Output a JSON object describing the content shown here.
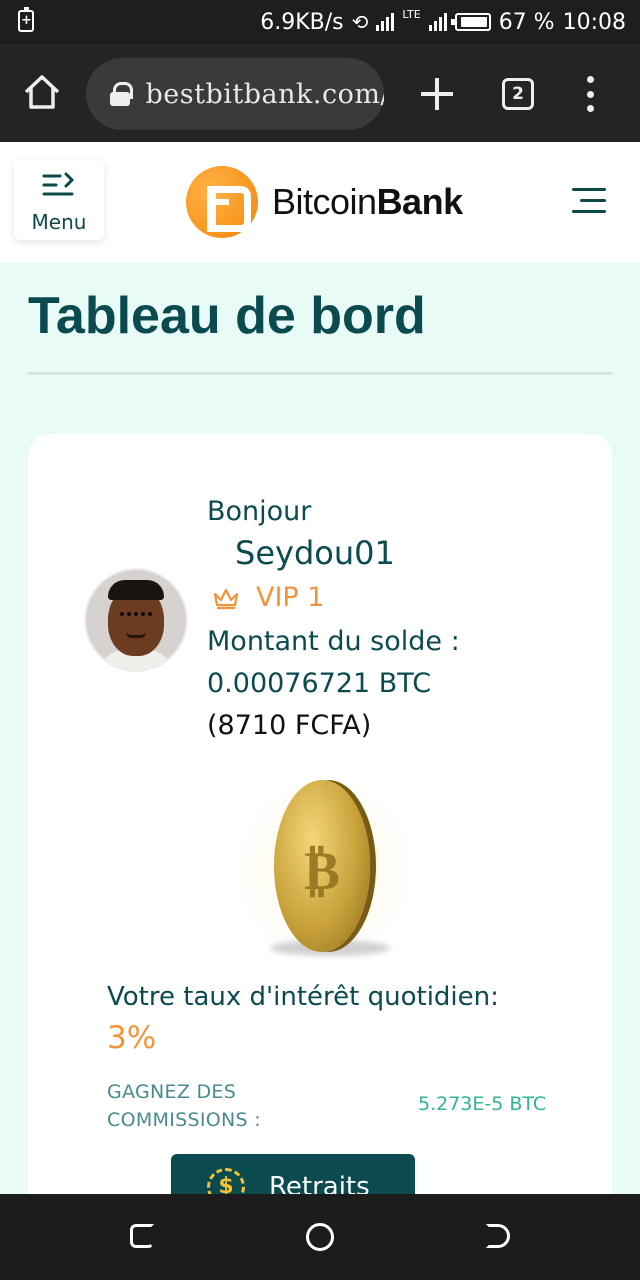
{
  "status_bar": {
    "speed": "6.9KB/s",
    "network": "LTE",
    "battery_percent": "67 %",
    "time": "10:08"
  },
  "browser": {
    "url": "bestbitbank.com/",
    "tab_count": "2"
  },
  "header": {
    "menu_label": "Menu",
    "logo_text_light": "Bitcoin",
    "logo_text_bold": "Bank",
    "brand_color": "#f7931a"
  },
  "page": {
    "title": "Tableau de bord"
  },
  "profile": {
    "greeting": "Bonjour",
    "username": "Seydou01",
    "vip_level": "VIP 1",
    "balance_label": "Montant du solde :",
    "balance_btc": "0.00076721 BTC",
    "balance_fcfa": "(8710 FCFA)"
  },
  "interest": {
    "label": "Votre taux d'intérêt quotidien:",
    "value": "3%"
  },
  "commissions": {
    "label": "GAGNEZ DES COMMISSIONS :",
    "value": "5.273E-5 BTC"
  },
  "actions": {
    "withdraw_label": "Retraits"
  },
  "colors": {
    "primary": "#0b4a4f",
    "accent": "#f2943a",
    "success": "#2fb68e",
    "background": "#e9fbf6"
  }
}
